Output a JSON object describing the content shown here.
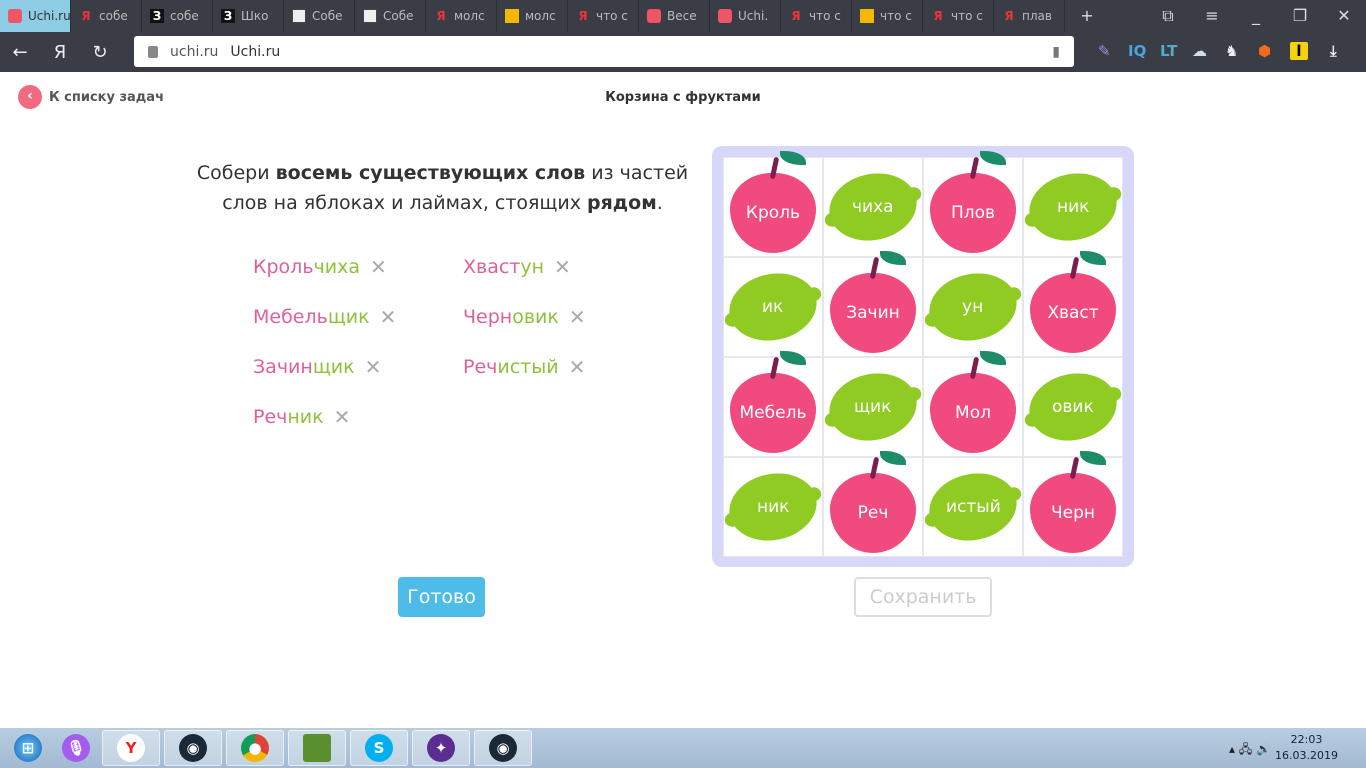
{
  "browser": {
    "tabs": [
      {
        "label": "Uchi.ru",
        "active": true,
        "icon": "uchi-icon"
      },
      {
        "label": "собе",
        "icon": "yandex-icon"
      },
      {
        "label": "собе",
        "icon": "znanija-icon"
      },
      {
        "label": "Шко",
        "icon": "znanija-icon"
      },
      {
        "label": "Собе",
        "icon": "qr-icon"
      },
      {
        "label": "Собе",
        "icon": "qr-icon"
      },
      {
        "label": "молс",
        "icon": "yandex-icon"
      },
      {
        "label": "молс",
        "icon": "image-icon"
      },
      {
        "label": "что с",
        "icon": "yandex-icon"
      },
      {
        "label": "Весе",
        "icon": "uchi-icon"
      },
      {
        "label": "Uchi.",
        "icon": "uchi-icon"
      },
      {
        "label": "что с",
        "icon": "yandex-icon"
      },
      {
        "label": "что с",
        "icon": "image-icon"
      },
      {
        "label": "что с",
        "icon": "yandex-icon"
      },
      {
        "label": "плав",
        "icon": "yandex-icon"
      }
    ],
    "new_tab": "+",
    "address_domain": "uchi.ru",
    "address_title": "Uchi.ru"
  },
  "page": {
    "back_label": "К списку задач",
    "title": "Корзина с фруктами",
    "task": {
      "t1": "Собери ",
      "b1": "восемь существующих слов",
      "t2": " из частей слов на яблоках и лаймах, стоящих ",
      "b2": "рядом",
      "t3": "."
    },
    "words": [
      {
        "pink": "Кроль",
        "green": "чиха"
      },
      {
        "pink": "Хваст",
        "green": "ун"
      },
      {
        "pink": "Мебель",
        "green": "щик"
      },
      {
        "pink": "Черн",
        "green": "овик"
      },
      {
        "pink": "Зачин",
        "green": "щик"
      },
      {
        "pink": "Реч",
        "green": "истый"
      },
      {
        "pink": "Реч",
        "green": "ник"
      }
    ],
    "remove_glyph": "✕",
    "done_label": "Готово",
    "save_label": "Сохранить",
    "grid": [
      {
        "type": "apple",
        "text": "Кроль"
      },
      {
        "type": "lime",
        "text": "чиха"
      },
      {
        "type": "apple",
        "text": "Плов"
      },
      {
        "type": "lime",
        "text": "ник"
      },
      {
        "type": "lime",
        "text": "ик"
      },
      {
        "type": "apple",
        "text": "Зачин"
      },
      {
        "type": "lime",
        "text": "ун"
      },
      {
        "type": "apple",
        "text": "Хваст"
      },
      {
        "type": "apple",
        "text": "Мебель"
      },
      {
        "type": "lime",
        "text": "щик"
      },
      {
        "type": "apple",
        "text": "Мол"
      },
      {
        "type": "lime",
        "text": "овик"
      },
      {
        "type": "lime",
        "text": "ник"
      },
      {
        "type": "apple",
        "text": "Реч"
      },
      {
        "type": "lime",
        "text": "истый"
      },
      {
        "type": "apple",
        "text": "Черн"
      }
    ],
    "colors": {
      "pink": "#e0609a",
      "green": "#8fc23a",
      "apple": "#f04a7e",
      "lime": "#8fcb22",
      "button": "#4dbce9"
    }
  },
  "taskbar": {
    "apps": [
      "start-icon",
      "alice-icon",
      "yandex-browser-icon",
      "steam-icon",
      "chrome-icon",
      "minecraft-icon",
      "skype-icon",
      "vpn-icon",
      "steam-icon"
    ],
    "time": "22:03",
    "date": "16.03.2019"
  }
}
